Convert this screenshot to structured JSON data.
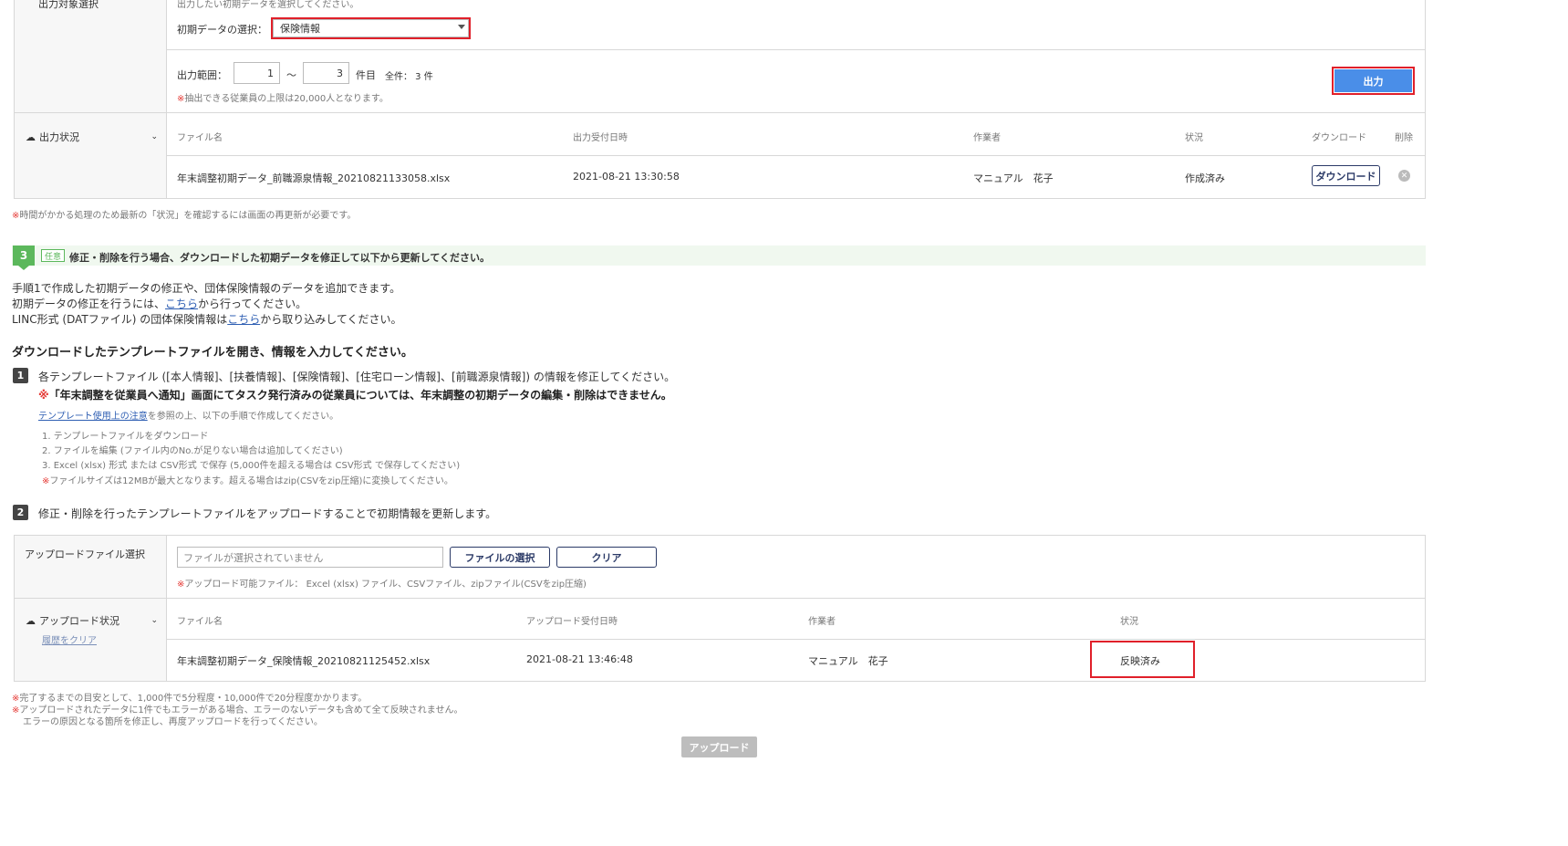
{
  "output_section": {
    "left_label": "出力対象選択",
    "helper_top": "出力したい初期データを選択してください。",
    "select_label": "初期データの選択：",
    "select_value": "保険情報",
    "range_label": "出力範囲：",
    "range_from": "1",
    "range_sep": "〜",
    "range_to": "3",
    "range_unit": "件目",
    "total_label": "全件： 3 件",
    "limit_note_mark": "※",
    "limit_note": "抽出できる従業員の上限は20,000人となります。",
    "output_button": "出力",
    "status_label": "出力状況",
    "table_headers": [
      "ファイル名",
      "出力受付日時",
      "作業者",
      "状況",
      "ダウンロード",
      "削除"
    ],
    "row": {
      "filename": "年末調整初期データ_前職源泉情報_20210821133058.xlsx",
      "datetime": "2021-08-21 13:30:58",
      "worker": "マニュアル　花子",
      "status": "作成済み",
      "download_button": "ダウンロード"
    },
    "refresh_note_mark": "※",
    "refresh_note": "時間がかかる処理のため最新の「状況」を確認するには画面の再更新が必要です。"
  },
  "step3": {
    "number": "3",
    "tag": "任意",
    "title": "修正・削除を行う場合、ダウンロードした初期データを修正して以下から更新してください。",
    "intro1": "手順1で作成した初期データの修正や、団体保険情報のデータを追加できます。",
    "intro2_pre": "初期データの修正を行うには、",
    "intro2_link": "こちら",
    "intro2_post": "から行ってください。",
    "intro3_pre": "LINC形式 (DATファイル) の団体保険情報は",
    "intro3_link": "こちら",
    "intro3_post": "から取り込みしてください。",
    "heading": "ダウンロードしたテンプレートファイルを開き、情報を入力してください。",
    "sub1_number": "1",
    "sub1_text": "各テンプレートファイル ([本人情報]、[扶養情報]、[保険情報]、[住宅ローン情報]、[前職源泉情報]) の情報を修正してください。",
    "sub1_warning_mark": "※",
    "sub1_warning": "「年末調整を従業員へ通知」画面にてタスク発行済みの従業員については、年末調整の初期データの編集・削除はできません。",
    "template_link": "テンプレート使用上の注意",
    "template_link_post": "を参照の上、以下の手順で作成してください。",
    "steps": [
      "1. テンプレートファイルをダウンロード",
      "2. ファイルを編集 (ファイル内のNo.が足りない場合は追加してください)",
      "3. Excel (xlsx) 形式 または CSV形式 で保存 (5,000件を超える場合は CSV形式 で保存してください)"
    ],
    "size_note_mark": "※",
    "size_note": "ファイルサイズは12MBが最大となります。超える場合はzip(CSVをzip圧縮)に変換してください。",
    "sub2_number": "2",
    "sub2_text": "修正・削除を行ったテンプレートファイルをアップロードすることで初期情報を更新します。"
  },
  "upload_section": {
    "left_label": "アップロードファイル選択",
    "file_placeholder": "ファイルが選択されていません",
    "select_button": "ファイルの選択",
    "clear_button": "クリア",
    "allowed_note_mark": "※",
    "allowed_note": "アップロード可能ファイル： Excel (xlsx) ファイル、CSVファイル、zipファイル(CSVをzip圧縮)",
    "status_label": "アップロード状況",
    "clear_history": "履歴をクリア",
    "table_headers": [
      "ファイル名",
      "アップロード受付日時",
      "作業者",
      "状況"
    ],
    "row": {
      "filename": "年末調整初期データ_保険情報_20210821125452.xlsx",
      "datetime": "2021-08-21 13:46:48",
      "worker": "マニュアル　花子",
      "status": "反映済み"
    },
    "notes": [
      {
        "mark": "※",
        "text": "完了するまでの目安として、1,000件で5分程度・10,000件で20分程度かかります。"
      },
      {
        "mark": "※",
        "text": "アップロードされたデータに1件でもエラーがある場合、エラーのないデータも含めて全て反映されません。"
      },
      {
        "mark": "",
        "text": "エラーの原因となる箇所を修正し、再度アップロードを行ってください。"
      }
    ],
    "upload_button": "アップロード"
  },
  "colors": {
    "primary_blue": "#4a8ee8",
    "highlight_red": "#e0202a",
    "step_green": "#5cb85c",
    "navy": "#2b3a67",
    "disabled_gray": "#bdbdbd"
  }
}
